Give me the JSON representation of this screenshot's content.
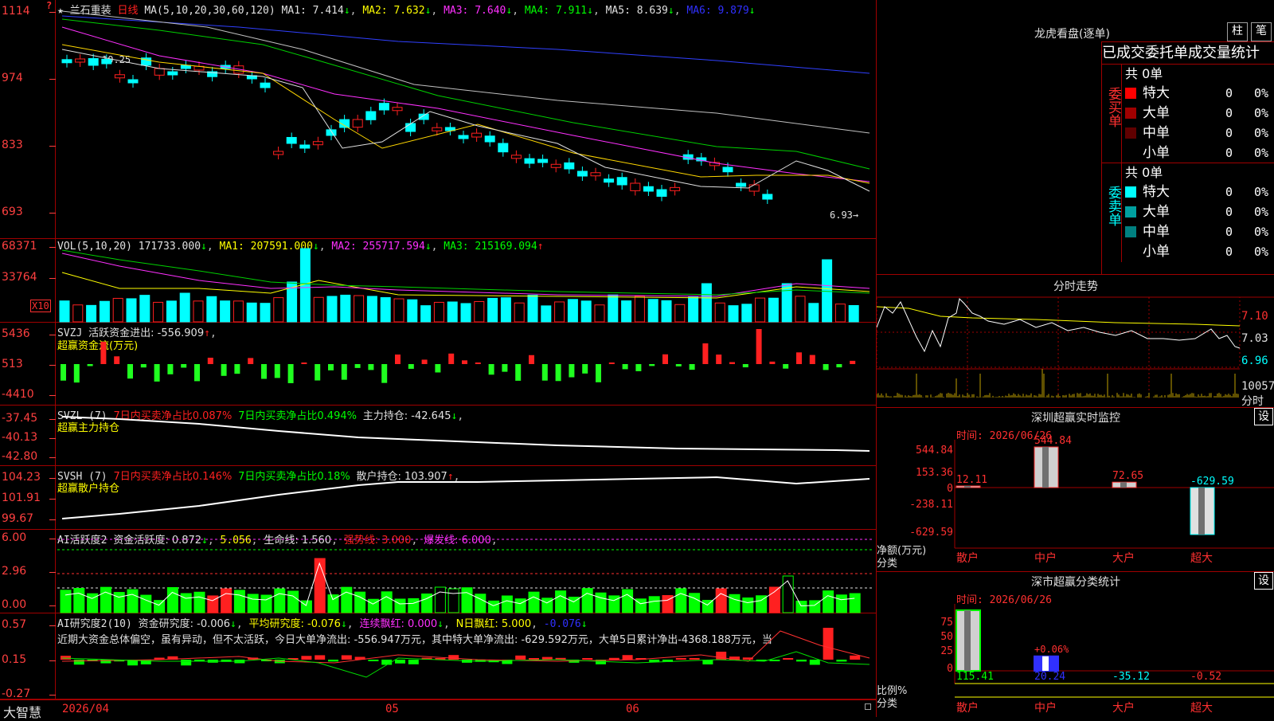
{
  "stock": {
    "star": "★",
    "name": "兰石重装",
    "period": "日线"
  },
  "main": {
    "ma_label": "MA(5,10,20,30,60,120)",
    "ma1": "MA1: 7.414",
    "ma2": "MA2: 7.632",
    "ma3": "MA3: 7.640",
    "ma4": "MA4: 7.911",
    "ma5": "MA5: 8.639",
    "ma6": "MA6: 9.879",
    "ticks": [
      "1114",
      "974",
      "833",
      "693"
    ],
    "high_label": "10.25",
    "low_label": "6.93→"
  },
  "vol": {
    "label": "VOL(5,10,20)",
    "value": "171733.000",
    "ma1": "MA1: 207591.000",
    "ma2": "MA2: 255717.594",
    "ma3": "MA3: 215169.094",
    "ticks": [
      "68371",
      "33764"
    ],
    "unit": "X10"
  },
  "svzj": {
    "label": "SVZJ",
    "title": "活跃资金进出: -556.909",
    "sub": "超赢资金流(万元)",
    "ticks": [
      "5436",
      "513",
      "-4410"
    ]
  },
  "svzl": {
    "label": "SVZL (7)",
    "a": "7日内买卖净占比0.087%",
    "b": "7日内买卖净占比0.494%",
    "c": "主力持仓: -42.645",
    "sub": "超赢主力持仓",
    "ticks": [
      "-37.45",
      "-40.13",
      "-42.80"
    ]
  },
  "svsh": {
    "label": "SVSH (7)",
    "a": "7日内买卖净占比0.146%",
    "b": "7日内买卖净占比0.18%",
    "c": "散户持仓: 103.907",
    "sub": "超赢散户持仓",
    "ticks": [
      "104.23",
      "101.91",
      "99.67"
    ]
  },
  "ai1": {
    "label": "AI活跃度2",
    "a": "资金活跃度: 0.872",
    "b": "5.056",
    "c": "生命线: 1.560",
    "d": "强势线: 3.000",
    "e": "爆发线: 6.000",
    "ticks": [
      "6.00",
      "2.96",
      "0.00"
    ]
  },
  "ai2": {
    "label": "AI研究度2(10)",
    "a": "资金研究度: -0.006",
    "b": "平均研究度: -0.076",
    "c": "连续飘红: 0.000",
    "d": "N日飘红: 5.000",
    "e": "-0.076",
    "text": "近期大资金总体偏空，虽有异动，但不太活跃，今日大单净流出: -556.947万元，其中特大单净流出: -629.592万元，大单5日累计净出-4368.188万元，当",
    "ticks": [
      "0.57",
      "0.15",
      "-0.27"
    ]
  },
  "footer": {
    "brand": "大智慧",
    "dates": [
      "2026/04",
      "05",
      "06"
    ]
  },
  "lhb": {
    "title": "龙虎看盘(逐单)",
    "btn1": "柱",
    "btn2": "笔",
    "header": "已成交委托单成交量统计",
    "buy_label": "委买单",
    "sell_label": "委卖单",
    "buy_total": "共 0单",
    "sell_total": "共 0单",
    "buy": [
      {
        "name": "特大",
        "v": "0",
        "p": "0%",
        "color": "#ff0000"
      },
      {
        "name": "大单",
        "v": "0",
        "p": "0%",
        "color": "#a00000"
      },
      {
        "name": "中单",
        "v": "0",
        "p": "0%",
        "color": "#600000"
      },
      {
        "name": "小单",
        "v": "0",
        "p": "0%",
        "color": "#000000"
      }
    ],
    "sell": [
      {
        "name": "特大",
        "v": "0",
        "p": "0%",
        "color": "#00ffff"
      },
      {
        "name": "大单",
        "v": "0",
        "p": "0%",
        "color": "#00a0a0"
      },
      {
        "name": "中单",
        "v": "0",
        "p": "0%",
        "color": "#008080"
      },
      {
        "name": "小单",
        "v": "0",
        "p": "0%",
        "color": "#000000"
      }
    ]
  },
  "fenshi": {
    "title": "分时走势",
    "ticks": [
      "7.10",
      "7.03",
      "6.96"
    ],
    "vol_tick": "10057",
    "vol_label": "分时"
  },
  "monitor": {
    "title": "深圳超赢实时监控",
    "btn": "设",
    "time": "时间: 2026/06/26",
    "ticks": [
      "544.84",
      "153.36",
      "0",
      "-238.11",
      "-629.59"
    ],
    "unit": "净额(万元)",
    "cat": "分类",
    "cats": [
      "散户",
      "中户",
      "大户",
      "超大"
    ],
    "values": [
      "12.11",
      "544.84",
      "72.65",
      "-629.59"
    ]
  },
  "stats": {
    "title": "深市超赢分类统计",
    "btn": "设",
    "time": "时间: 2026/06/26",
    "ticks": [
      "75",
      "50",
      "25",
      "0"
    ],
    "unit": "比例%",
    "cat": "分类",
    "cats": [
      "散户",
      "中户",
      "大户",
      "超大"
    ],
    "values": [
      "115.41",
      "20.24",
      "-35.12",
      "-0.52"
    ],
    "bar_label": "+0.06%"
  }
}
